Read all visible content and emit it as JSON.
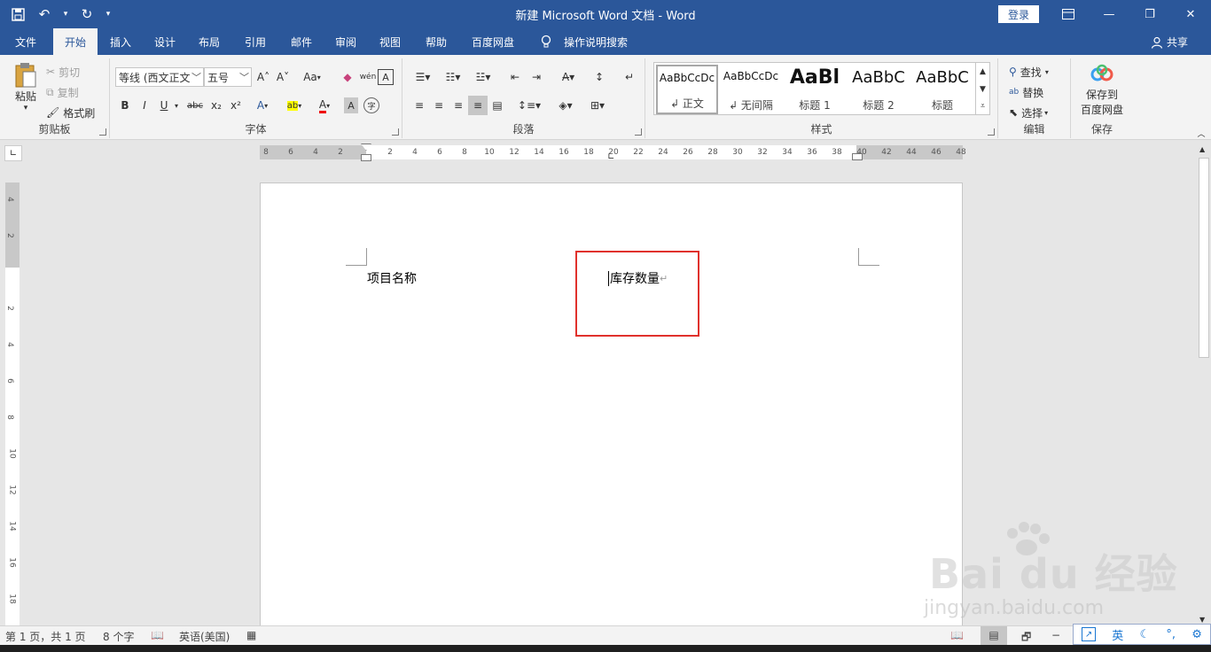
{
  "window": {
    "title": "新建 Microsoft Word 文档  -  Word",
    "login": "登录",
    "minimize": "—",
    "restore": "❐",
    "close": "✕"
  },
  "tabs": [
    "文件",
    "开始",
    "插入",
    "设计",
    "布局",
    "引用",
    "邮件",
    "审阅",
    "视图",
    "帮助",
    "百度网盘",
    "操作说明搜索"
  ],
  "active_tab": "开始",
  "share": "共享",
  "clipboard": {
    "paste": "粘贴",
    "cut": "剪切",
    "copy": "复制",
    "format_painter": "格式刷",
    "label": "剪贴板"
  },
  "font": {
    "font_name": "等线 (西文正文",
    "font_size": "五号",
    "label": "字体",
    "bold": "B",
    "italic": "I",
    "underline": "U",
    "strike": "abc",
    "sub": "x₂",
    "sup": "x²",
    "grow": "A˄",
    "shrink": "A˅",
    "case": "Aa",
    "pinyin": "wén",
    "char_border": "A",
    "text_effect": "A",
    "highlight": "ab",
    "color": "A",
    "shading": "A",
    "enclose": "字"
  },
  "paragraph": {
    "label": "段落"
  },
  "styles": {
    "label": "样式",
    "items": [
      {
        "preview": "AaBbCcDc",
        "name": "↲ 正文"
      },
      {
        "preview": "AaBbCcDc",
        "name": "↲ 无间隔"
      },
      {
        "preview": "AaBl",
        "name": "标题 1"
      },
      {
        "preview": "AaBbC",
        "name": "标题 2"
      },
      {
        "preview": "AaBbC",
        "name": "标题"
      }
    ]
  },
  "editing": {
    "label": "编辑",
    "find": "查找",
    "replace": "替换",
    "select": "选择"
  },
  "save_group": {
    "label": "保存",
    "save_to": "保存到",
    "baidu": "百度网盘"
  },
  "ruler": {
    "ticks": [
      "8",
      "6",
      "4",
      "2",
      "",
      "2",
      "4",
      "6",
      "8",
      "10",
      "12",
      "14",
      "16",
      "18",
      "20",
      "22",
      "24",
      "26",
      "28",
      "30",
      "32",
      "34",
      "36",
      "38",
      "40",
      "42",
      "44",
      "46",
      "48"
    ],
    "vticks": [
      "4",
      "2",
      "",
      "2",
      "4",
      "6",
      "8",
      "10",
      "12",
      "14",
      "16",
      "18"
    ]
  },
  "document": {
    "cell1": "项目名称",
    "cell2": "库存数量",
    "para_mark": "↵"
  },
  "status": {
    "page": "第 1 页，共 1 页",
    "words": "8 个字",
    "language": "英语(美国)",
    "zoom_minus": "−"
  },
  "ime": [
    "英",
    "☾",
    "°,",
    "⚙"
  ],
  "watermark": {
    "brand": "Bai du 经验",
    "site": "jingyan.baidu.com"
  }
}
